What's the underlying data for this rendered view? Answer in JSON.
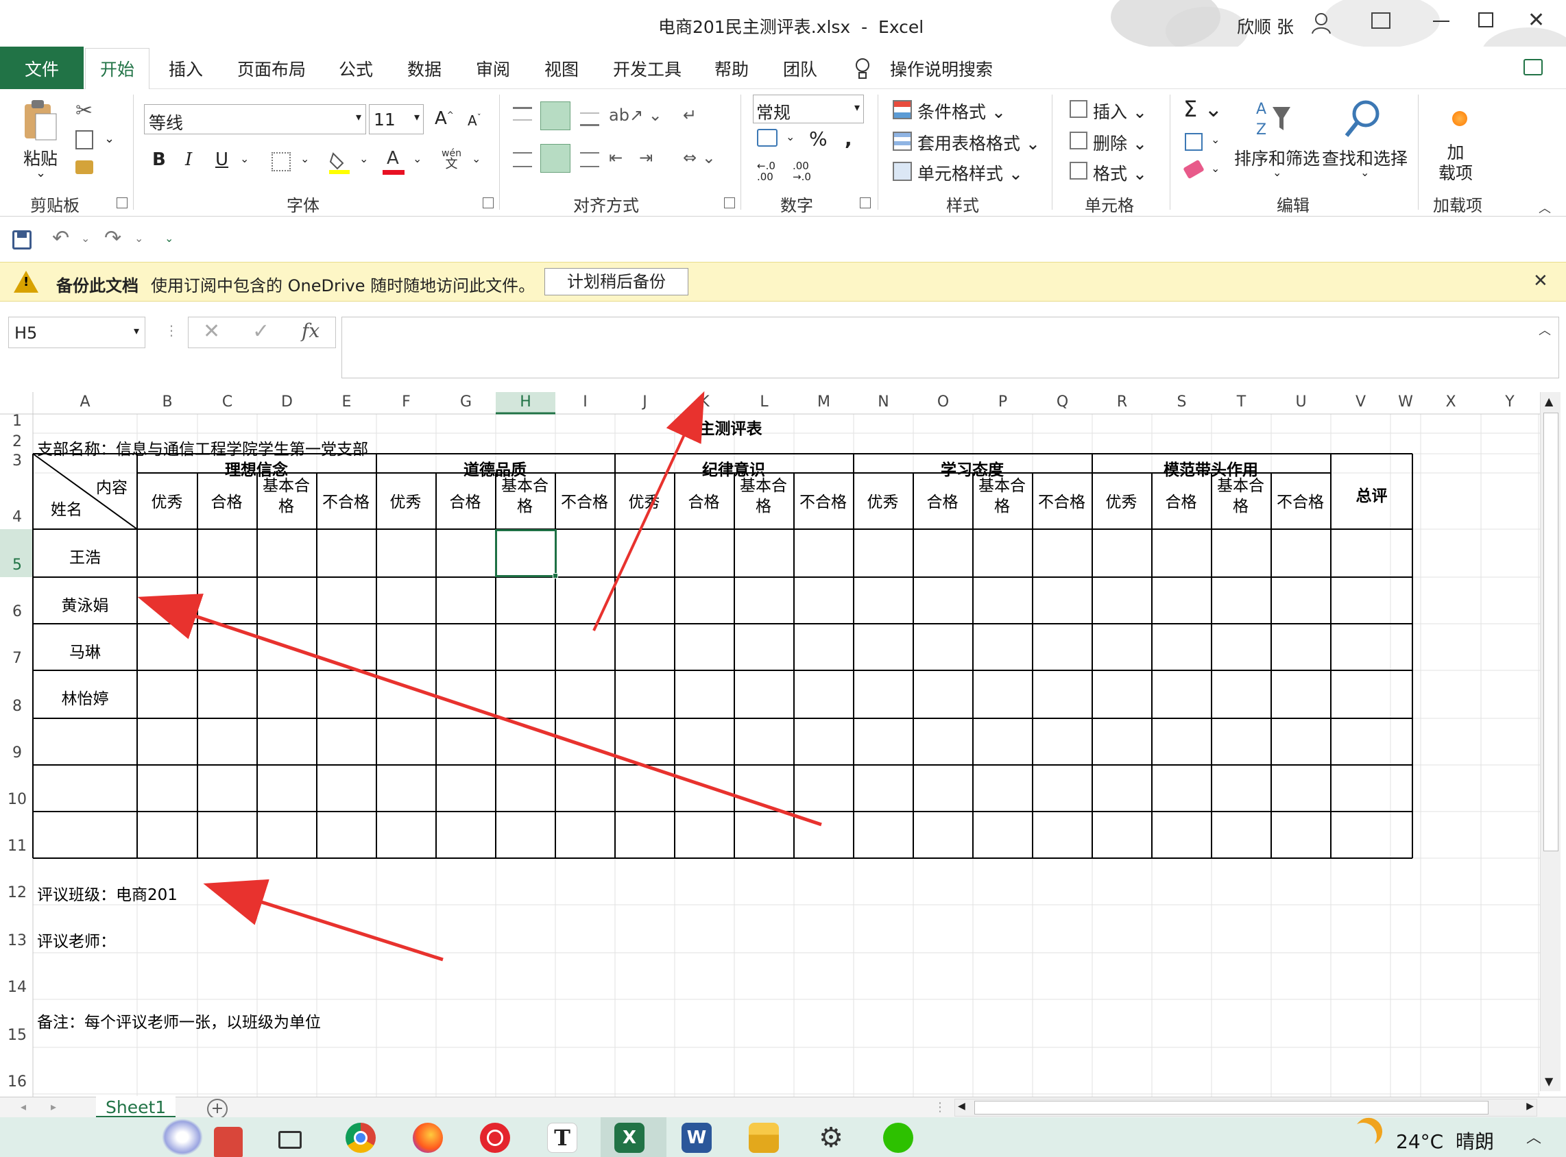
{
  "window": {
    "title": "电商201民主测评表.xlsx  -  Excel",
    "user": "欣顺 张"
  },
  "tabs": [
    "文件",
    "开始",
    "插入",
    "页面布局",
    "公式",
    "数据",
    "审阅",
    "视图",
    "开发工具",
    "帮助",
    "团队"
  ],
  "tell_me": "操作说明搜索",
  "ribbon": {
    "clipboard": {
      "paste": "粘贴",
      "label": "剪贴板"
    },
    "font": {
      "name": "等线",
      "size": "11",
      "label": "字体",
      "bold": "B",
      "italic": "I",
      "underline": "U",
      "wen": "wén\n文"
    },
    "alignment": {
      "label": "对齐方式"
    },
    "number": {
      "format": "常规",
      "percent": "%",
      "comma": "\t",
      "label": "数字",
      "inc": "←.0\n.00",
      "dec": ".00\n→.0"
    },
    "styles": {
      "cond": "条件格式",
      "table": "套用表格格式",
      "cell": "单元格样式",
      "label": "样式"
    },
    "cells": {
      "insert": "插入",
      "delete": "删除",
      "format": "格式",
      "label": "单元格"
    },
    "editing": {
      "sort": "排序和筛选",
      "find": "查找和选择",
      "label": "编辑"
    },
    "addins": {
      "add": "加\n载项",
      "label": "加载项"
    }
  },
  "message_bar": {
    "title": "备份此文档",
    "text": "使用订阅中包含的 OneDrive 随时随地访问此文件。",
    "button": "计划稍后备份"
  },
  "formula_bar": {
    "name_box": "H5",
    "fx": "fx",
    "value": ""
  },
  "columns": [
    "A",
    "B",
    "C",
    "D",
    "E",
    "F",
    "G",
    "H",
    "I",
    "J",
    "K",
    "L",
    "M",
    "N",
    "O",
    "P",
    "Q",
    "R",
    "S",
    "T",
    "U",
    "V",
    "W",
    "X",
    "Y"
  ],
  "rows": [
    "1",
    "2",
    "3",
    "4",
    "5",
    "6",
    "7",
    "8",
    "9",
    "10",
    "11",
    "12",
    "13",
    "14",
    "15",
    "16"
  ],
  "sheet": {
    "title": "民主测评表",
    "branch": "支部名称：信息与通信工程学院学生第一党支部",
    "diag_top": "内容",
    "diag_bottom": "姓名",
    "categories": [
      "理想信念",
      "道德品质",
      "纪律意识",
      "学习态度",
      "模范带头作用"
    ],
    "grades": [
      "优秀",
      "合格",
      "基本合\n格",
      "不合格"
    ],
    "total": "总评",
    "names": [
      "王浩",
      "黄泳娟",
      "马琳",
      "林怡婷"
    ],
    "class_line": "评议班级：电商201",
    "teacher_line": "评议老师：",
    "note_line": "备注：每个评议老师一张，以班级为单位"
  },
  "sheet_tab": "Sheet1",
  "taskbar": {
    "weather": "24°C  晴朗"
  },
  "colors": {
    "excel_green": "#217346",
    "arrow": "#e8322e",
    "selection": "#1e7145",
    "msg_bg": "#fdf6c6"
  }
}
